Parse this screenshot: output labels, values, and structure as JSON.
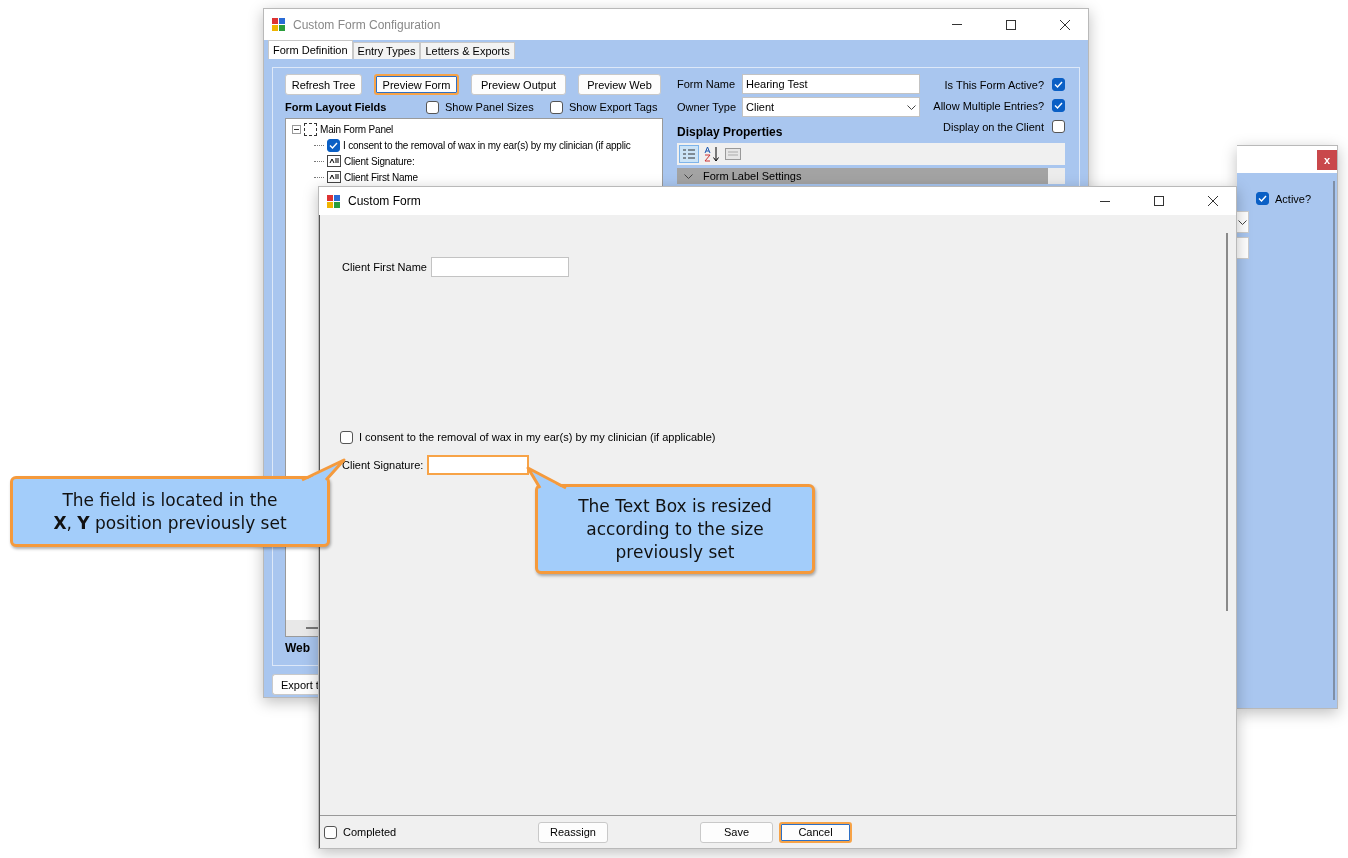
{
  "back_window": {
    "close_label": "x",
    "active": {
      "label": "Active?",
      "checked": true
    }
  },
  "config_window": {
    "title": "Custom Form Configuration",
    "tabs": [
      {
        "label": "Form Definition",
        "selected": true
      },
      {
        "label": "Entry Types",
        "selected": false
      },
      {
        "label": "Letters & Exports",
        "selected": false
      }
    ],
    "buttons": [
      {
        "label": "Refresh Tree",
        "highlighted": false
      },
      {
        "label": "Preview Form",
        "highlighted": true
      },
      {
        "label": "Preview Output",
        "highlighted": false
      },
      {
        "label": "Preview Web",
        "highlighted": false
      }
    ],
    "layout_fields_title": "Form Layout Fields",
    "options": [
      {
        "label": "Show Panel Sizes",
        "checked": false
      },
      {
        "label": "Show Export Tags",
        "checked": false
      }
    ],
    "tree": [
      {
        "kind": "panel",
        "label": "Main Form Panel",
        "expanded": true,
        "children": [
          {
            "kind": "checkbox",
            "label": "I consent to the removal of wax in my ear(s) by my clinician (if applic",
            "checked": true
          },
          {
            "kind": "text",
            "label": "Client Signature:"
          },
          {
            "kind": "text",
            "label": "Client First Name"
          }
        ]
      }
    ],
    "web_label": "Web",
    "export_button": "Export t",
    "form_name": {
      "label": "Form Name",
      "value": "Hearing Test"
    },
    "owner_type": {
      "label": "Owner Type",
      "value": "Client"
    },
    "flags": [
      {
        "label": "Is This Form Active?",
        "checked": true
      },
      {
        "label": "Allow Multiple Entries?",
        "checked": true
      },
      {
        "label": "Display on the Client",
        "checked": false
      }
    ],
    "display_properties": {
      "title": "Display Properties",
      "category": "Form Label Settings"
    }
  },
  "preview_window": {
    "title": "Custom Form",
    "fields": [
      {
        "kind": "text",
        "label": "Client First Name",
        "highlighted": false
      },
      {
        "kind": "checkbox",
        "label": "I consent to the removal of wax in my ear(s) by my clinician (if applicable)",
        "checked": false
      },
      {
        "kind": "text",
        "label": "Client Signature:",
        "highlighted": true
      }
    ],
    "completed": {
      "label": "Completed",
      "checked": false
    },
    "buttons": [
      {
        "label": "Reassign",
        "highlighted": false
      },
      {
        "label": "Save",
        "highlighted": false
      },
      {
        "label": "Cancel",
        "highlighted": true
      }
    ]
  },
  "callouts": [
    {
      "text": "The field is located in the **X**, **Y** position previously set"
    },
    {
      "text": "The Text Box is resized according to the size previously set"
    }
  ]
}
